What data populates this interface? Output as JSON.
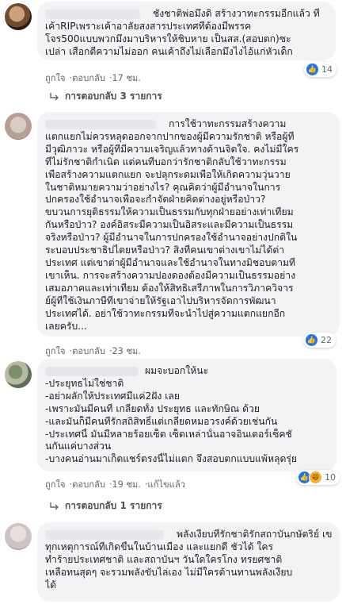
{
  "comments": [
    {
      "name_hidden": true,
      "lines": [
        "ชังชาติพ่อมึงดิ สร้างวาทะกรรมอีกแล้ว ที่",
        "เค้าRIPเพราะเค้าอาลัยสงสารประเทศที่ต้องมีพรรค",
        "โจร500แบบพวกมึงมาบริหารให้ชิบหาย เป็นสส.(สอบตก)ซะ",
        "เปล่า เสือกตีความไม่ออก คนเค้าถึงไม่เลือกมึงไงไอ้แก่หัวเด็ก"
      ],
      "like_label": "ถูกใจ",
      "reply_label": "ตอบกลับ",
      "time": "17 ชม.",
      "reaction_count": "14",
      "replies_label": "การตอบกลับ 3 รายการ"
    },
    {
      "name_hidden": true,
      "lines": [
        "การใช้วาทะกรรมสร้างความ",
        "แตกแยกไม่ควรหลุดออกจากปากของผู้มีความรักชาติ หรือผู้ที่",
        "มีวุฒิภาวะ หรือผู้ที่มีความเจริญแล้วทางด้านจิตใจ. คงไม่มีใคร",
        "ที่ไม่รักชาติกำเนิด แต่คนที่บอกว่ารักชาติกลับใช้วาทะกรรม",
        "เพื่อสร้างความแตกแยก จะปลุกระดมเพื่อให้เกิดความวุ่นวาย",
        "ในชาติหมายความว่าอย่างไร? คุณคิดว่าผู้มีอำนาจในการ",
        "ปกครองใช้อำนาจเพื่อจะกำจัดฝ่ายคิดต่างอยู่หรือป่าว?",
        "ขบวนการยุติธรรมให้ความเป็นธรรมกับทุกฝ่ายอย่างเท่าเทียม",
        "กันหรือป่าว? องค์อิสระมีความเป็นอิสระและมีความเป็นธรรม",
        "จริงหรือป่าว? ผู้มีอำนาจในการปกครองใช้อำนาจอย่างปกติใน",
        "ระบอบประชาธิปไตยหรือป่าว? สิ่งที่คนเขาต่างเขาไม่ได้ต่า",
        "ประเทศ แต่เขาต่าผู้มีอำนาจและใช้อำนาจในทางมิชอบตามที่",
        "เขาเห็น. การจะสร้างความปองดองต้องมีความเป็นธรรมอย่าง",
        "เสมอภาคและเท่าเทียม ต้องให้สิทธิเสรีภาพในการวิภาควิจาร",
        "ย์ผู้ที่ใช้เงินภาษีที่เขาจ่ายให้รัฐเอาไปบริหารจัดการพัฒนา",
        "ประเทศได้. อย่าใช้วาทะกรรมที่จะนำไปสู่ความแตกแยกอีก",
        "เลยครับ..."
      ],
      "like_label": "ถูกใจ",
      "reply_label": "ตอบกลับ",
      "time": "23 ชม.",
      "reaction_count": "22"
    },
    {
      "name_hidden": true,
      "lines": [
        "ผมจะบอกให้นะ",
        "-ประยุทธไม่ใช่ชาติ",
        "-อย่าผลักให้ประเทศมีแค่2ฝั่ง เลย",
        "-เพราะมันมีคนที่ เกลียดทั้ง ประยุทธ และทักษิณ ด้วย",
        "-และมันก็มีคนที่รักสถิสิทธิ์แต่เกลียดหมอวรงค์ด้วยเช่นกัน",
        "-ประเทศนี้ มันมีหลายร้อยเซ็ต เซ็ตเหล่านั้นอาจอินเตอร์เซ็คชั่",
        "นกันแค่บางส่วน",
        "-บางคนอ่านมาเก็ตแชร์ตรงนี้ไม่แตก จึงสอบตกแบบแพ้หลุดรุ่ย"
      ],
      "like_label": "ถูกใจ",
      "reply_label": "ตอบกลับ",
      "time": "19 ชม.",
      "edited": "แก้ไขแล้ว",
      "reaction_count": "10",
      "replies_label": "การตอบกลับ 1 รายการ"
    },
    {
      "name_hidden": true,
      "lines": [
        "พลังเงียบที่รักชาติรักสถาบันกษัตริย์ เขารู้",
        "ทุกเหตุการณ์ที่เกิดขึ้นในบ้านเมือง และแยกดี ชั่วได้ ใคร",
        "ทำร้ายประเทศชาติ และสถาบันฯ วันใดใครโกง ทรยศชาติ",
        "เหลือทนสุดๆ จะรวมพลังขับไล่เอง ไม่มีใครต้านทานพลังเงียบ",
        "ได้"
      ]
    }
  ]
}
